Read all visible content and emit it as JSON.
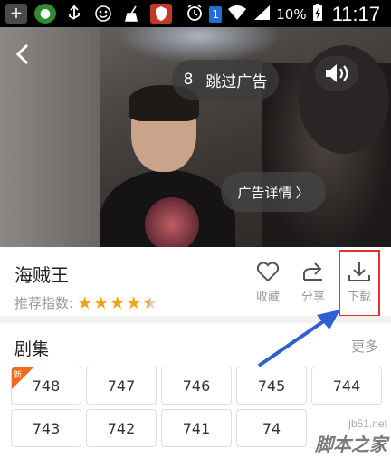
{
  "status_bar": {
    "app_icons": [
      "plus-square-icon",
      "circle-app-icon",
      "usb-icon",
      "emoji-icon",
      "broom-icon",
      "shield-icon"
    ],
    "notification_count": "1",
    "battery_percent": "10%",
    "time": "11:17"
  },
  "video": {
    "skip_countdown": "8",
    "skip_label": "跳过广告",
    "ad_detail_label": "广告详情",
    "ad_detail_chevron": "〉"
  },
  "info": {
    "title": "海贼王",
    "rating_label": "推荐指数:",
    "rating_stars": 4.5,
    "actions": {
      "favorite": "收藏",
      "share": "分享",
      "download": "下载"
    }
  },
  "episodes": {
    "title": "剧集",
    "more": "更多",
    "new_badge": "新",
    "row1": [
      "748",
      "747",
      "746",
      "745",
      "744"
    ],
    "row2": [
      "743",
      "742",
      "741",
      "74"
    ]
  },
  "watermark": {
    "site": "jb51.net",
    "name": "脚本之家"
  },
  "colors": {
    "star": "#f4a316",
    "highlight_box": "#e3322e",
    "arrow": "#2f5fd0",
    "new_badge": "#f06a1a"
  }
}
